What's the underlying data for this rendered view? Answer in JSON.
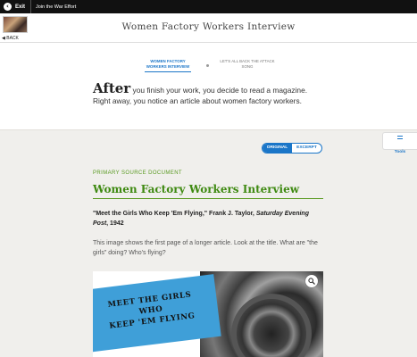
{
  "topbar": {
    "exit_label": "Exit",
    "app_title": "Join the War Effort"
  },
  "header": {
    "back_label": "BACK",
    "page_title": "Women Factory Workers Interview"
  },
  "steps": {
    "active": "WOMEN FACTORY WORKERS INTERVIEW",
    "next": "LET'S ALL BACK THE ATTACK SONG"
  },
  "intro": {
    "lead": "After",
    "text": " you finish your work, you decide to read a magazine. Right away, you notice an article about women factory workers."
  },
  "toggle": {
    "original": "ORIGINAL",
    "excerpt": "EXCERPT"
  },
  "tools": {
    "label": "Tools"
  },
  "document": {
    "kicker": "PRIMARY SOURCE DOCUMENT",
    "title": "Women Factory Workers Interview",
    "citation_title": "\"Meet the Girls Who Keep 'Em Flying,\" Frank J. Taylor,",
    "citation_source": "Saturday Evening Post",
    "citation_year": ", 1942",
    "description": "This image shows the first page of a longer article. Look at the title. What are \"the girls\" doing? Who's flying?",
    "image_headline": [
      "MEET THE GIRLS",
      "WHO",
      "KEEP 'EM FLYING"
    ]
  }
}
